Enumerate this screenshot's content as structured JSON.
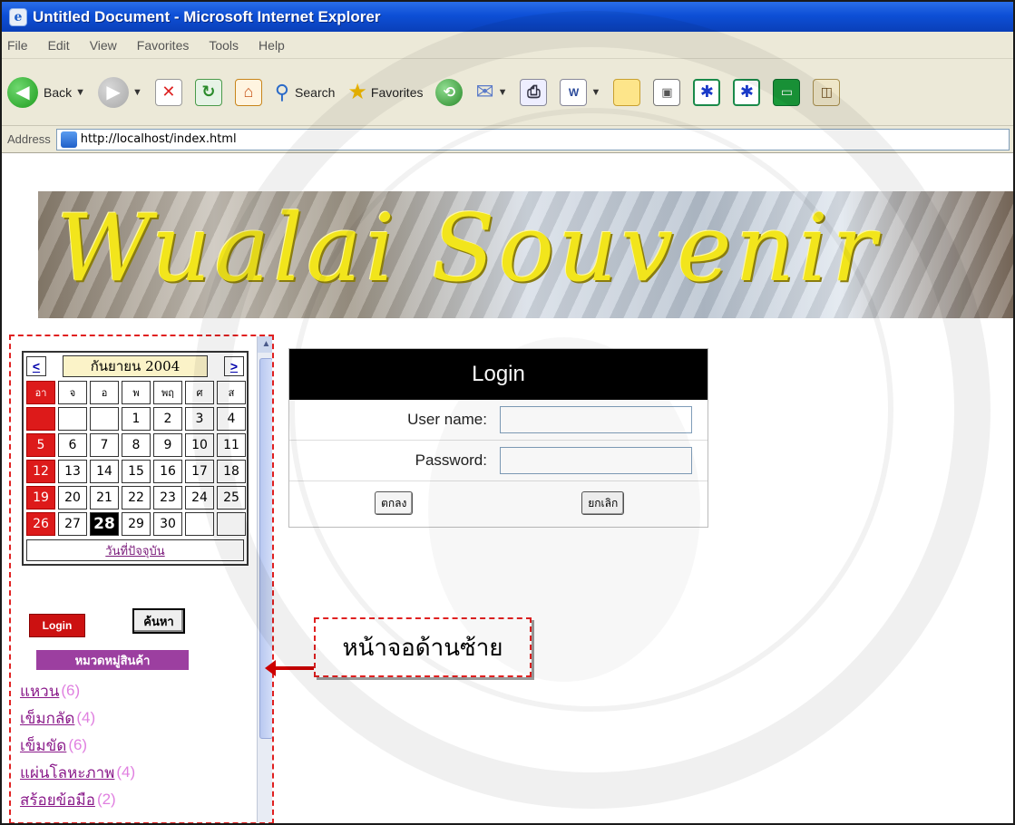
{
  "window": {
    "title": "Untitled Document - Microsoft Internet Explorer"
  },
  "menu": [
    "File",
    "Edit",
    "View",
    "Favorites",
    "Tools",
    "Help"
  ],
  "toolbar": {
    "back_label": "Back",
    "search_label": "Search",
    "favorites_label": "Favorites"
  },
  "address": {
    "label": "Address",
    "url": "http://localhost/index.html"
  },
  "banner": {
    "title": "Wualai Souvenir"
  },
  "calendar": {
    "prev": "<",
    "next": ">",
    "month_year": "กันยายน 2004",
    "weekdays": [
      "อา",
      "จ",
      "อ",
      "พ",
      "พฤ",
      "ศ",
      "ส"
    ],
    "rows": [
      [
        "",
        "",
        "",
        "1",
        "2",
        "3",
        "4"
      ],
      [
        "5",
        "6",
        "7",
        "8",
        "9",
        "10",
        "11"
      ],
      [
        "12",
        "13",
        "14",
        "15",
        "16",
        "17",
        "18"
      ],
      [
        "19",
        "20",
        "21",
        "22",
        "23",
        "24",
        "25"
      ],
      [
        "26",
        "27",
        "28",
        "29",
        "30",
        "",
        ""
      ]
    ],
    "today_link": "วันที่ปัจจุบัน",
    "today": "28"
  },
  "sidebar": {
    "login_button": "Login",
    "search_button": "ค้นหา",
    "category_header": "หมวดหมู่สินค้า",
    "categories": [
      {
        "name": "แหวน",
        "count": "(6)"
      },
      {
        "name": "เข็มกลัด",
        "count": "(4)"
      },
      {
        "name": "เข็มขัด",
        "count": "(6)"
      },
      {
        "name": "แผ่นโลหะภาพ",
        "count": "(4)"
      },
      {
        "name": "สร้อยข้อมือ",
        "count": "(2)"
      }
    ]
  },
  "login": {
    "title": "Login",
    "username_label": "User name:",
    "password_label": "Password:",
    "ok_button": "ตกลง",
    "cancel_button": "ยกเลิก"
  },
  "annotation": {
    "text": "หน้าจอด้านซ้าย"
  },
  "colors": {
    "accent": "#dd1a1a",
    "category": "#9c3fa0",
    "annotation": "#e02020"
  }
}
